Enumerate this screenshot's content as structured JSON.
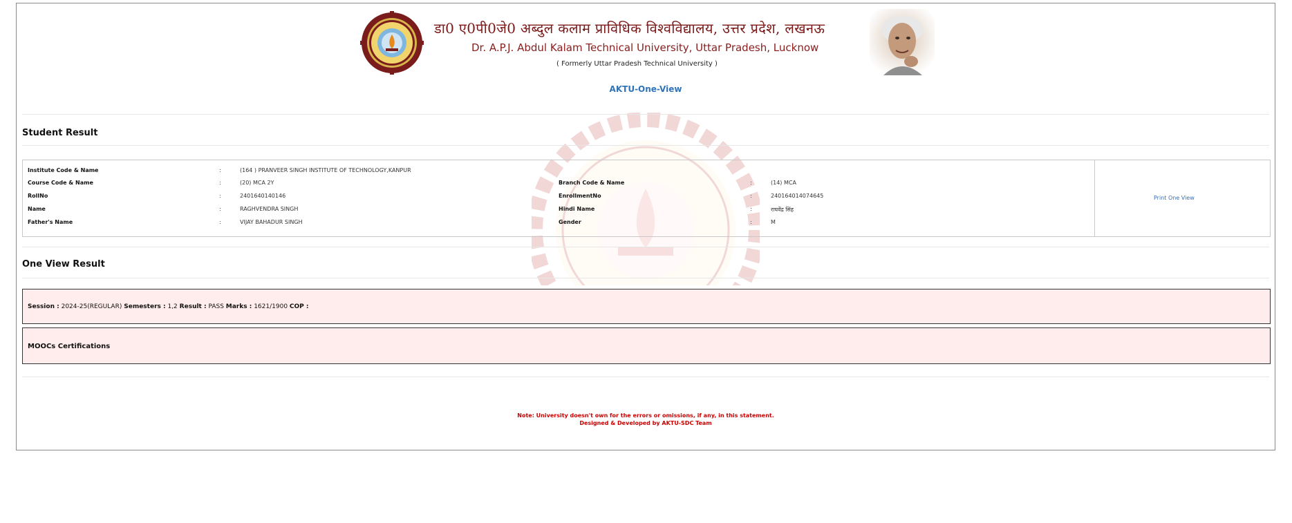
{
  "header": {
    "title_hindi": "डा0 ए0पी0जे0 अब्दुल कलाम प्राविधिक विश्वविद्यालय, उत्तर प्रदेश, लखनऊ",
    "title_english": "Dr. A.P.J. Abdul Kalam Technical University, Uttar Pradesh, Lucknow",
    "formerly": "( Formerly Uttar Pradesh Technical University )",
    "app_title": "AKTU-One-View"
  },
  "student_result": {
    "heading": "Student Result",
    "separator": ":",
    "fields": {
      "institute": {
        "label": "Institute Code & Name",
        "value": "(164 ) PRANVEER SINGH INSTITUTE OF TECHNOLOGY,KANPUR"
      },
      "course": {
        "label": "Course Code & Name",
        "value": "(20) MCA 2Y"
      },
      "rollno": {
        "label": "RollNo",
        "value": "2401640140146"
      },
      "name": {
        "label": "Name",
        "value": "RAGHVENDRA SINGH"
      },
      "father": {
        "label": "Father's Name",
        "value": "VIJAY BAHADUR SINGH"
      },
      "branch": {
        "label": "Branch Code & Name",
        "value": "(14) MCA"
      },
      "enrollment": {
        "label": "EnrollmentNo",
        "value": "240164014074645"
      },
      "hindi_name": {
        "label": "Hindi Name",
        "value": "राघवेंद्र सिंह"
      },
      "gender": {
        "label": "Gender",
        "value": "M"
      }
    },
    "print_link": "Print One View"
  },
  "one_view": {
    "heading": "One View Result",
    "session_label": "Session :",
    "session_value": "2024-25(REGULAR)",
    "semesters_label": "Semesters :",
    "semesters_value": "1,2",
    "result_label": "Result :",
    "result_value": "PASS",
    "marks_label": "Marks :",
    "marks_value": "1621/1900",
    "cop_label": "COP :",
    "moocs_label": "MOOCs Certifications"
  },
  "footer": {
    "note": "Note: University doesn't own for the errors or omissions, if any, in this statement.",
    "credit": "Designed & Developed by AKTU-SDC Team"
  },
  "colors": {
    "title_red": "#7b1818",
    "link_blue": "#2f73b8",
    "panel_bg": "#ffeded",
    "note_red": "#cc0000"
  }
}
